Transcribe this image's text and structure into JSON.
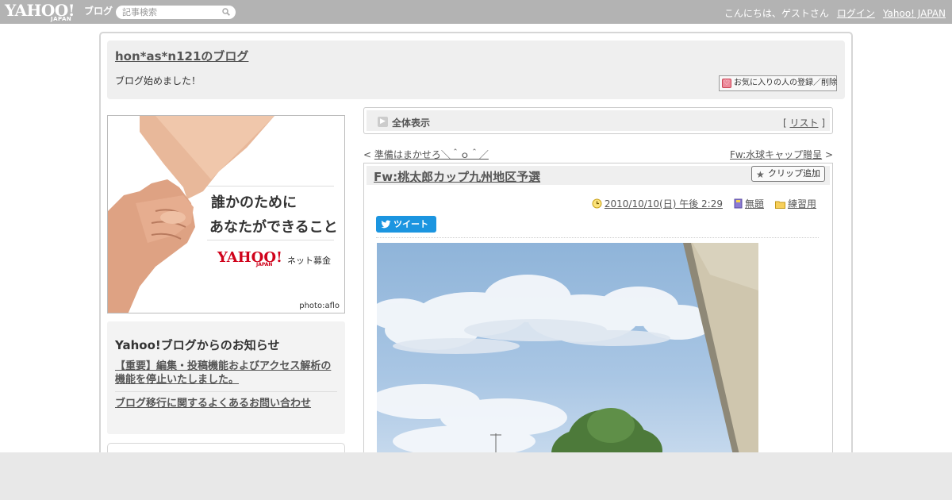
{
  "topbar": {
    "logo_text": "YAHOO!",
    "logo_sub": "JAPAN",
    "logo_service": "ブログ",
    "search_placeholder": "記事検索",
    "greeting": "こんにちは、ゲストさん",
    "login_label": "ログイン",
    "yahoo_japan_label": "Yahoo! JAPAN"
  },
  "blog": {
    "title": "hon*as*n121のブログ",
    "description": "ブログ始めました！",
    "favorite_button": "お気に入りの人の登録／削除"
  },
  "ad": {
    "line1": "誰かのために",
    "line2": "あなたができること",
    "brand": "YAHOO!",
    "brand_sub": "JAPAN",
    "service": "ネット募金",
    "credit": "photo:aflo"
  },
  "notice": {
    "heading": "Yahoo!ブログからのお知らせ",
    "link1": "【重要】編集・投稿機能およびアクセス解析の機能を停止いたしました。",
    "link2": "ブログ移行に関するよくあるお問い合わせ"
  },
  "view": {
    "label": "全体表示",
    "list_open": "[ ",
    "list_label": "リスト",
    "list_close": " ]"
  },
  "nav": {
    "prev_prefix": "< ",
    "prev_label": "準備はまかせろ＼＾ｏ＾／",
    "next_label": "Fw:水球キャップ贈呈",
    "next_suffix": " >"
  },
  "article": {
    "title": "Fw:桃太郎カップ九州地区予選",
    "clip_label": "クリップ追加",
    "datetime": "2010/10/10(日) 午後 2:29",
    "tag": "無題",
    "category": "練習用",
    "tweet_label": "ツイート"
  },
  "colors": {
    "topbar": "#b3b3b3",
    "panel": "#efefef",
    "tweet": "#1b95e0",
    "link": "#555555",
    "footer": "#e8e8e8"
  }
}
